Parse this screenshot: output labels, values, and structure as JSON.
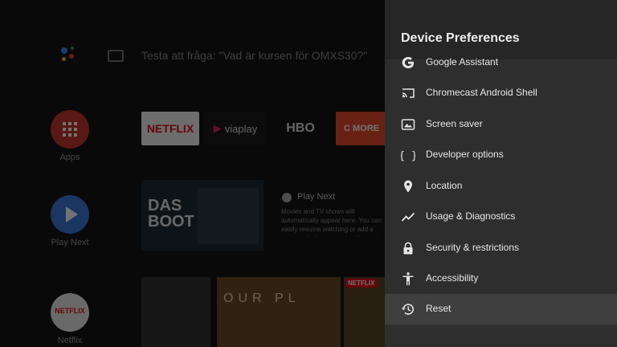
{
  "home": {
    "search_hint": "Testa att fråga: \"Vad är kursen för OMXS30?\"",
    "left_column": [
      {
        "label": "Apps"
      },
      {
        "label": "Play Next"
      },
      {
        "label": "Netflix"
      }
    ],
    "apps_row": [
      "NETFLIX",
      "viaplay",
      "HBO",
      "C MORE"
    ],
    "play_next": {
      "title": "Play Next",
      "poster_text": "DAS BOOT",
      "description": "Movies and TV shows will automatically appear here. You can easily resume watching or add a program by long-pressing the center button."
    },
    "bottom_row": {
      "netflix_badge": "NETFLIX",
      "tile_text": "OUR PL"
    }
  },
  "panel": {
    "title": "Device Preferences",
    "items": [
      {
        "label": "Google Assistant",
        "icon": "google-icon"
      },
      {
        "label": "Chromecast Android Shell",
        "icon": "cast-icon"
      },
      {
        "label": "Screen saver",
        "icon": "screensaver-icon"
      },
      {
        "label": "Developer options",
        "icon": "braces-icon"
      },
      {
        "label": "Location",
        "icon": "location-pin-icon"
      },
      {
        "label": "Usage & Diagnostics",
        "icon": "trending-icon"
      },
      {
        "label": "Security & restrictions",
        "icon": "lock-icon"
      },
      {
        "label": "Accessibility",
        "icon": "accessibility-icon"
      },
      {
        "label": "Reset",
        "icon": "history-icon",
        "selected": true
      }
    ]
  },
  "colors": {
    "panel_bg": "#2e2e2e",
    "selected_row": "#3f3f3f",
    "netflix_red": "#e50914"
  }
}
